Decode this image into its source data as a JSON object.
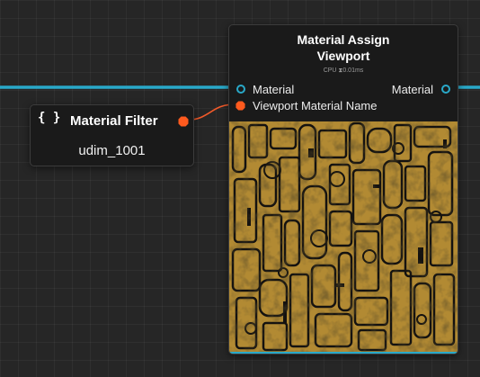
{
  "colors": {
    "background": "#262626",
    "node_bg": "#1a1a1a",
    "material_wire": "#29a9c9",
    "string_wire": "#f25a2a",
    "port_orange": "#ff5a1e",
    "texture_gold": "#c29a38"
  },
  "filter_node": {
    "icon": "curly-braces-icon",
    "icon_glyph": "{ }",
    "title": "Material Filter",
    "value": "udim_1001"
  },
  "assign_node": {
    "title": "Material Assign\nViewport",
    "cpu": "CPU ⧗0.01ms",
    "inputs": [
      "Material",
      "Viewport Material Name"
    ],
    "outputs": [
      "Material"
    ],
    "preview": "texture-preview-image"
  }
}
